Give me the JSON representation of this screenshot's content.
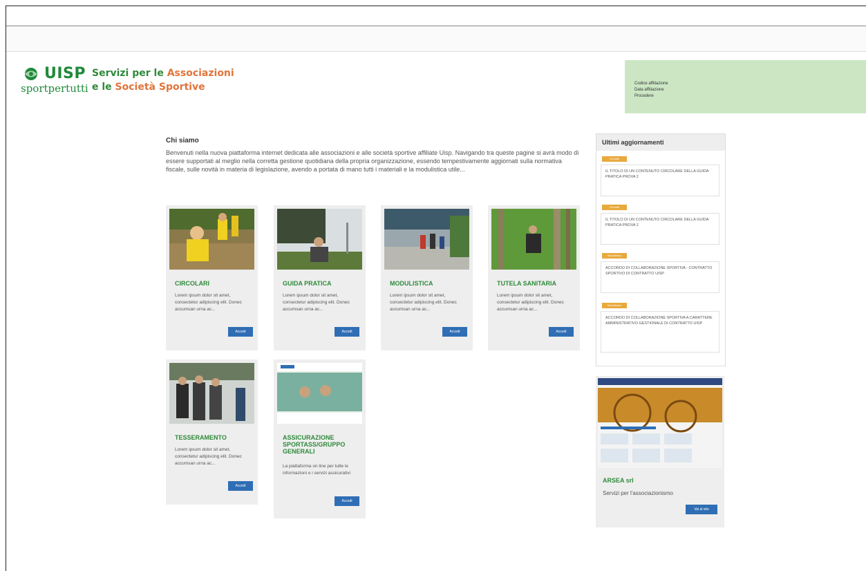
{
  "header": {
    "logo_main": "UISP",
    "logo_sub": "sportpertutti",
    "tagline_1a": "Servizi per",
    "tagline_1b": "le",
    "tagline_1c": "Associazioni",
    "tagline_2a": "e le",
    "tagline_2b": "Società Sportive",
    "login_lines": [
      "Codice affiliazione",
      "Data affiliazione",
      "Procedere"
    ]
  },
  "intro": {
    "title": "Chi siamo",
    "text": "Benvenuti nella nuova piattaforma internet dedicata alle associazioni e alle società sportive affiliate Uisp. Navigando tra queste pagine si avrà modo di essere supportati al meglio nella corretta gestione quotidiana della propria organizzazione, essendo tempestivamente aggiornati sulla normativa fiscale, sulle novità in materia di legislazione, avendo a portata di mano tutti i materiali e la modulistica utile..."
  },
  "cards": [
    {
      "title": "CIRCOLARI",
      "text": "Lorem ipsum dolor sit amet, consectetur adipiscing elit. Donec accumsan urna ac...",
      "button": "Accedi"
    },
    {
      "title": "GUIDA PRATICA",
      "text": "Lorem ipsum dolor sit amet, consectetur adipiscing elit. Donec accumsan urna ac...",
      "button": "Accedi"
    },
    {
      "title": "MODULISTICA",
      "text": "Lorem ipsum dolor sit amet, consectetur adipiscing elit. Donec accumsan urna ac...",
      "button": "Accedi"
    },
    {
      "title": "TUTELA SANITARIA",
      "text": "Lorem ipsum dolor sit amet, consectetur adipiscing elit. Donec accumsan urna ac...",
      "button": "Accedi"
    },
    {
      "title": "TESSERAMENTO",
      "text": "Lorem ipsum dolor sit amet, consectetur adipiscing elit. Donec accumsan urna ac...",
      "button": "Accedi"
    },
    {
      "title": "ASSICURAZIONE SPORTASS/GRUPPO GENERALI",
      "text": "La piattaforma on line per tutte le informazioni e i servizi assicurativi",
      "button": "Accedi"
    }
  ],
  "sidebar": {
    "title": "Ultimi aggiornamenti",
    "items": [
      {
        "tag": "Circolari",
        "text": "IL TITOLO DI UN CONTENUTO CIRCOLARE DELLA GUIDA PRATICA PROVA 2"
      },
      {
        "tag": "Circolari",
        "text": "IL TITOLO DI UN CONTENUTO CIRCOLARE DELLA GUIDA PRATICA PROVA 2"
      },
      {
        "tag": "Modulistica",
        "text": "ACCORDO DI COLLABORAZIONE SPORTIVA - CONTRATTO SPORTIVO DI CONTRATTO UISP"
      },
      {
        "tag": "Modulistica",
        "text": "ACCORDO DI COLLABORAZIONE SPORTIVA A CARATTERE AMMINISTRATIVO GESTIONALE DI CONTRATTO UISP"
      }
    ]
  },
  "promo": {
    "title": "ARSEA srl",
    "text": "Servizi per l'associazionismo",
    "button": "Vai al sito"
  },
  "colors": {
    "brand_green": "#2f8a3a",
    "brand_orange": "#e0743a",
    "button_blue": "#2f6eb5",
    "tag_orange": "#e8a93d",
    "login_bg": "#cce6c4"
  }
}
